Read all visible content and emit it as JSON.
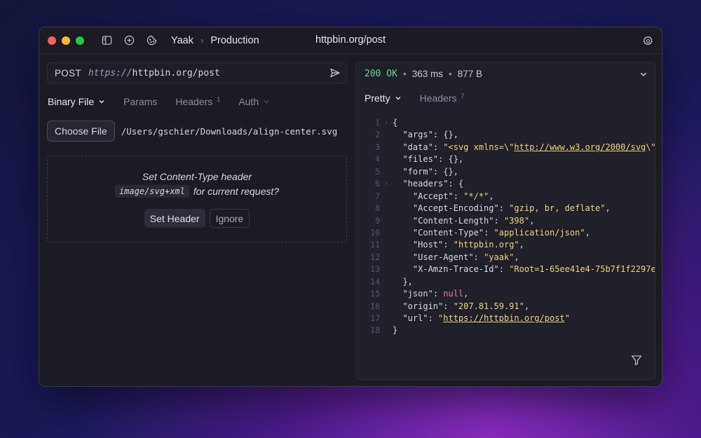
{
  "titlebar": {
    "app_name": "Yaak",
    "environment": "Production",
    "window_title": "httpbin.org/post",
    "icons": [
      "sidebar-toggle-icon",
      "plus-circle-icon",
      "cookie-icon",
      "gear-icon"
    ]
  },
  "request": {
    "method": "POST",
    "url_scheme": "https://",
    "url_host": "httpbin.org/post",
    "tabs": [
      {
        "label": "Binary File",
        "badge": ""
      },
      {
        "label": "Params",
        "badge": ""
      },
      {
        "label": "Headers",
        "badge": "1"
      },
      {
        "label": "Auth",
        "badge": ""
      }
    ],
    "choose_file_label": "Choose File",
    "file_path": "/Users/gschier/Downloads/align-center.svg",
    "hint": {
      "line1": "Set Content-Type header",
      "content_type": "image/svg+xml",
      "line2_suffix": "for current request?",
      "set_header_label": "Set Header",
      "ignore_label": "Ignore"
    }
  },
  "response": {
    "status": "200 OK",
    "time": "363 ms",
    "size": "877 B",
    "tabs": [
      {
        "label": "Pretty",
        "badge": ""
      },
      {
        "label": "Headers",
        "badge": "7"
      }
    ],
    "line_numbers": [
      "1",
      "2",
      "3",
      "4",
      "5",
      "6",
      "7",
      "8",
      "9",
      "10",
      "11",
      "12",
      "13",
      "14",
      "15",
      "16",
      "17",
      "18"
    ]
  },
  "colors": {
    "status_ok": "#6bd68a",
    "string": "#f0d27a",
    "null": "#ef7aa6"
  }
}
